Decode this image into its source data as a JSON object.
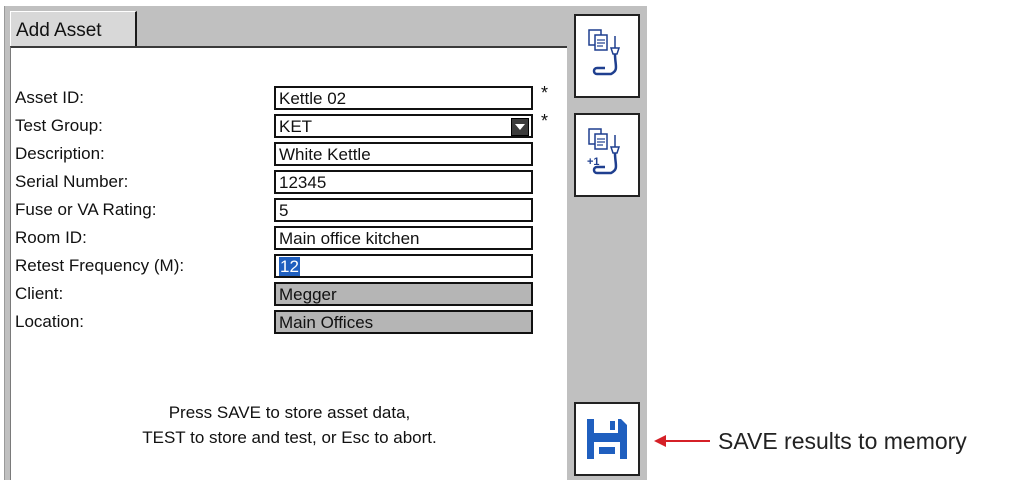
{
  "tab": {
    "label": "Add Asset"
  },
  "form": {
    "rows": [
      {
        "label": "Asset ID:",
        "value": "Kettle 02",
        "required": "*"
      },
      {
        "label": "Test Group:",
        "value": "KET",
        "required": "*"
      },
      {
        "label": "Description:",
        "value": "White Kettle"
      },
      {
        "label": "Serial Number:",
        "value": "12345"
      },
      {
        "label": "Fuse or VA Rating:",
        "value": "5"
      },
      {
        "label": "Room ID:",
        "value": "Main office kitchen"
      },
      {
        "label": "Retest Frequency (M):",
        "value": "12"
      },
      {
        "label": "Client:",
        "value": "Megger"
      },
      {
        "label": "Location:",
        "value": "Main Offices"
      }
    ]
  },
  "message": {
    "line1": "Press SAVE to store asset data,",
    "line2": "TEST to store and test, or Esc to abort."
  },
  "side_buttons": {
    "copy_icon": "copy-asset-icon",
    "copy_increment_icon": "copy-asset-increment-icon",
    "save_icon": "floppy-disk-icon",
    "increment_badge": "+1"
  },
  "annotation": {
    "text": "SAVE results to memory",
    "color": "#d52027"
  },
  "colors": {
    "selection": "#1f5fbf",
    "save_icon": "#1f5fbf",
    "readonly_field": "#b5b5b5"
  }
}
